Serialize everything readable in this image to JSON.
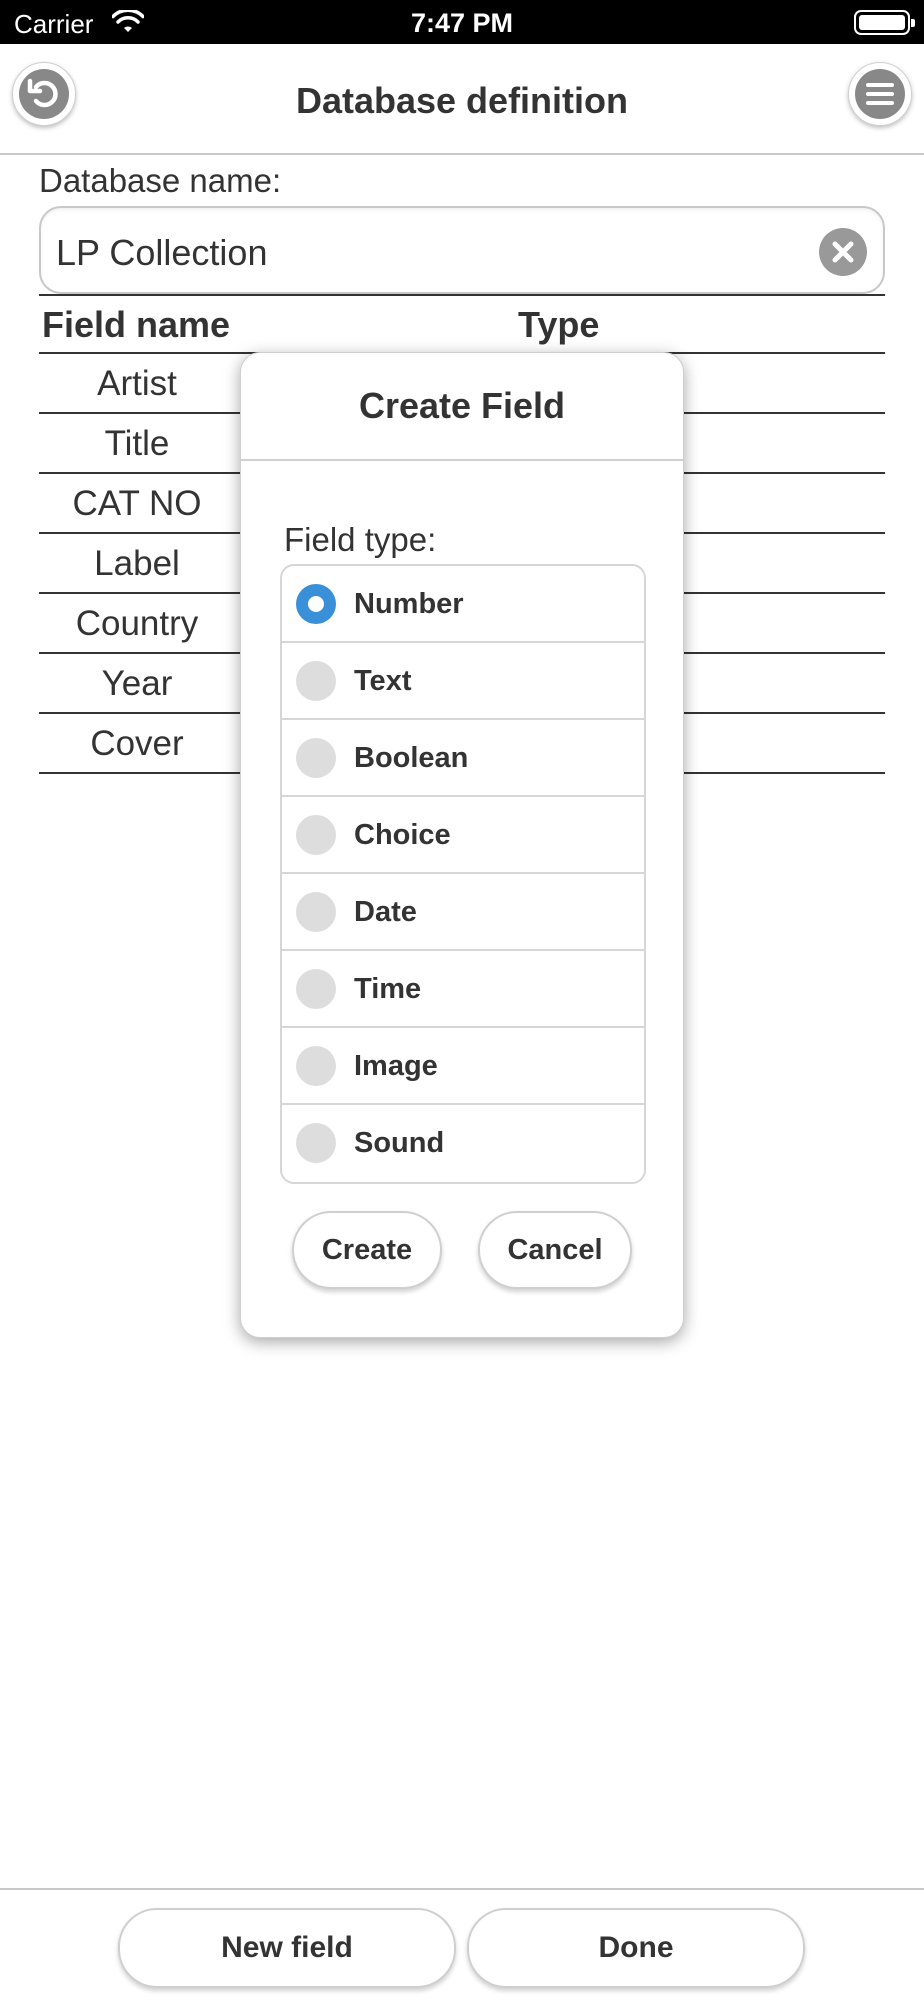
{
  "status_bar": {
    "carrier": "Carrier",
    "time": "7:47 PM"
  },
  "header": {
    "title": "Database definition",
    "back_icon": "undo-arrow-icon",
    "menu_icon": "hamburger-menu-icon"
  },
  "form": {
    "database_name_label": "Database name:",
    "database_name_value": "LP Collection"
  },
  "fields_table": {
    "columns": [
      "Field name",
      "Type"
    ],
    "rows": [
      "Artist",
      "Title",
      "CAT NO",
      "Label",
      "Country",
      "Year",
      "Cover"
    ]
  },
  "dialog": {
    "title": "Create Field",
    "field_type_label": "Field type:",
    "options": [
      "Number",
      "Text",
      "Boolean",
      "Choice",
      "Date",
      "Time",
      "Image",
      "Sound"
    ],
    "selected_option": "Number",
    "create_label": "Create",
    "cancel_label": "Cancel"
  },
  "toolbar": {
    "new_field_label": "New field",
    "done_label": "Done"
  },
  "colors": {
    "accent": "#3a8fd9",
    "text": "#333333",
    "icon_gray": "#888888"
  }
}
